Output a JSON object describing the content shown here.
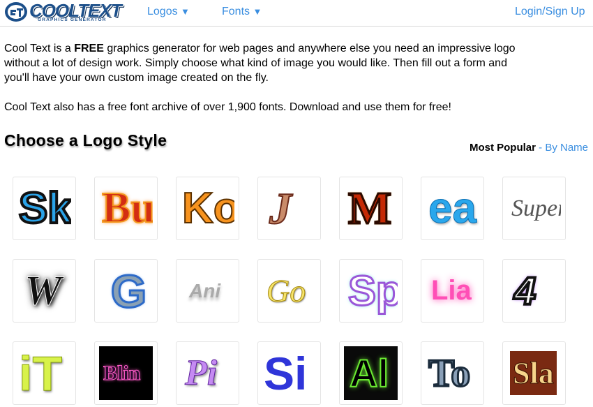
{
  "header": {
    "logo_main": "COOLTEXT",
    "logo_sub": "GRAPHICS GENERATOR",
    "nav": [
      {
        "label": "Logos",
        "caret": "▼"
      },
      {
        "label": "Fonts",
        "caret": "▼"
      }
    ],
    "login_label": "Login/Sign Up"
  },
  "intro": {
    "p1_a": "Cool Text is a ",
    "p1_bold": "FREE",
    "p1_b": " graphics generator for web pages and anywhere else you need an impressive logo without a lot of design work.  Simply choose what kind of image you would like. Then fill out a form and you'll have your own custom image created on the fly.",
    "p2": "Cool Text also has a free font archive of over 1,900 fonts. Download and use them for free!"
  },
  "section": {
    "title": "Choose a Logo Style",
    "sort_active": "Most Popular",
    "sort_sep": " - ",
    "sort_other": "By Name"
  },
  "logo_styles": [
    {
      "text": "Sk"
    },
    {
      "text": "Bu"
    },
    {
      "text": "Ko"
    },
    {
      "text": "J"
    },
    {
      "text": "M"
    },
    {
      "text": "ea"
    },
    {
      "text": "Super"
    },
    {
      "text": "W"
    },
    {
      "text": "G"
    },
    {
      "text": "Ani"
    },
    {
      "text": "Go"
    },
    {
      "text": "Sp"
    },
    {
      "text": "Lia"
    },
    {
      "text": "4"
    },
    {
      "text": "iT"
    },
    {
      "text": "Blin"
    },
    {
      "text": "Pi"
    },
    {
      "text": "Si"
    },
    {
      "text": "Al"
    },
    {
      "text": "To"
    },
    {
      "text": "Sla"
    }
  ],
  "colors": {
    "link": "#3a8ee0",
    "brand": "#1c4f8a"
  }
}
